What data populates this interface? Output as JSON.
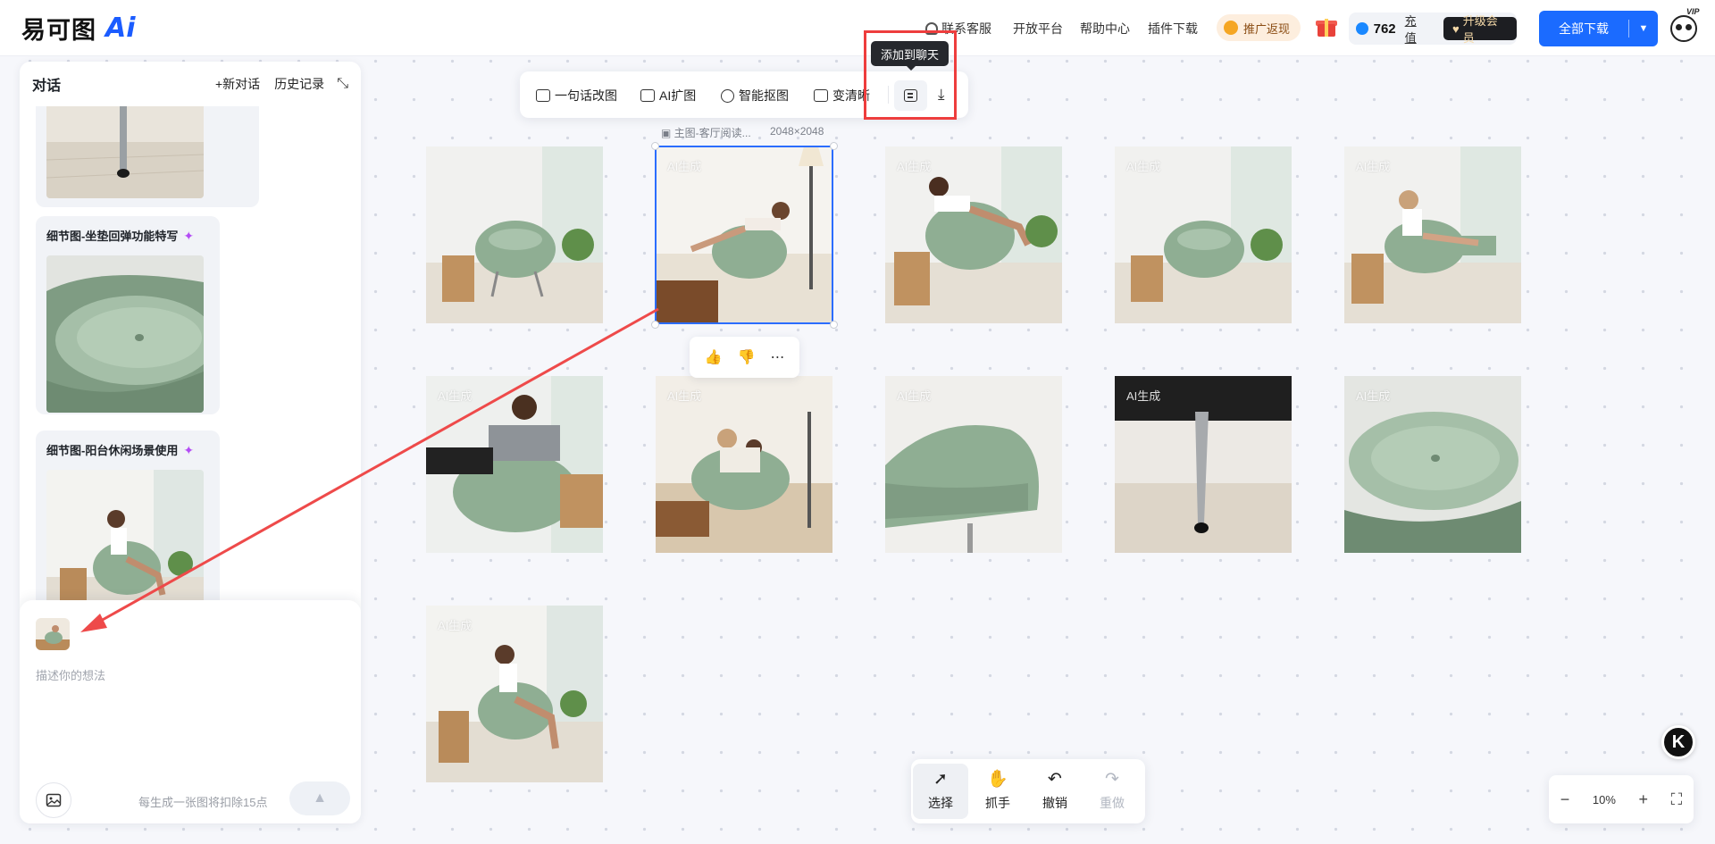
{
  "header": {
    "logo_text": "易可图",
    "logo_ai": "Ai",
    "nav": [
      "联系客服",
      "开放平台",
      "帮助中心",
      "插件下载"
    ],
    "promo": "推广返现",
    "points": "762",
    "recharge": "充值",
    "upgrade": "升级会员",
    "download_all": "全部下载",
    "vip": "VIP"
  },
  "panel": {
    "title": "对话",
    "new_chat": "+新对话",
    "history": "历史记录",
    "messages": [
      {
        "title": "细节图-坐垫回弹功能特写"
      },
      {
        "title": "细节图-阳台休闲场景使用"
      }
    ],
    "placeholder": "描述你的想法",
    "cost_hint": "每生成一张图将扣除15点"
  },
  "toolbar": {
    "items": [
      "一句话改图",
      "AI扩图",
      "智能抠图",
      "变清晰"
    ],
    "tooltip": "添加到聊天"
  },
  "canvas": {
    "selected_label": "主图-客厅阅读...",
    "selected_dims": "2048×2048",
    "ai_mark": "AI生成"
  },
  "bottom_tools": {
    "select": "选择",
    "grab": "抓手",
    "undo": "撤销",
    "redo": "重做"
  },
  "zoom": {
    "level": "10%"
  },
  "colors": {
    "accent": "#1b6bff",
    "highlight": "#ee3d3d",
    "chair": "#8fae93"
  }
}
